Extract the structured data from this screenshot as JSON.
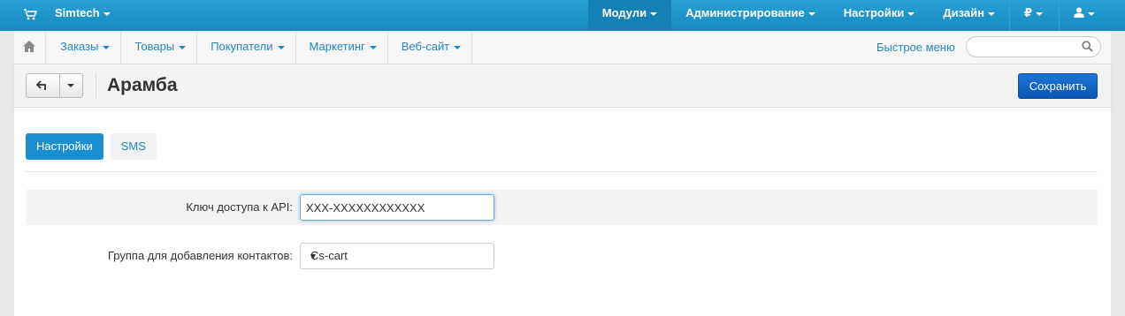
{
  "topbar": {
    "brand": "Simtech",
    "menu": [
      {
        "label": "Модули",
        "active": true
      },
      {
        "label": "Администрирование",
        "active": false
      },
      {
        "label": "Настройки",
        "active": false
      },
      {
        "label": "Дизайн",
        "active": false
      }
    ],
    "currency": "₽"
  },
  "subnav": {
    "items": [
      "Заказы",
      "Товары",
      "Покупатели",
      "Маркетинг",
      "Веб-сайт"
    ],
    "quick_menu": "Быстрое меню",
    "search_value": ""
  },
  "page": {
    "title": "Арамба",
    "save_label": "Сохранить"
  },
  "tabs": [
    {
      "label": "Настройки",
      "active": true
    },
    {
      "label": "SMS",
      "active": false
    }
  ],
  "form": {
    "api_key_label": "Ключ доступа к API:",
    "api_key_value": "XXX-XXXXXXXXXXXX",
    "group_label": "Группа для добавления контактов:",
    "group_value": "Cs-cart"
  },
  "colors": {
    "topbar": "#1c97cf",
    "link": "#2486c1",
    "primary_button": "#0d5dbd",
    "active_tab": "#1a8fd0"
  }
}
